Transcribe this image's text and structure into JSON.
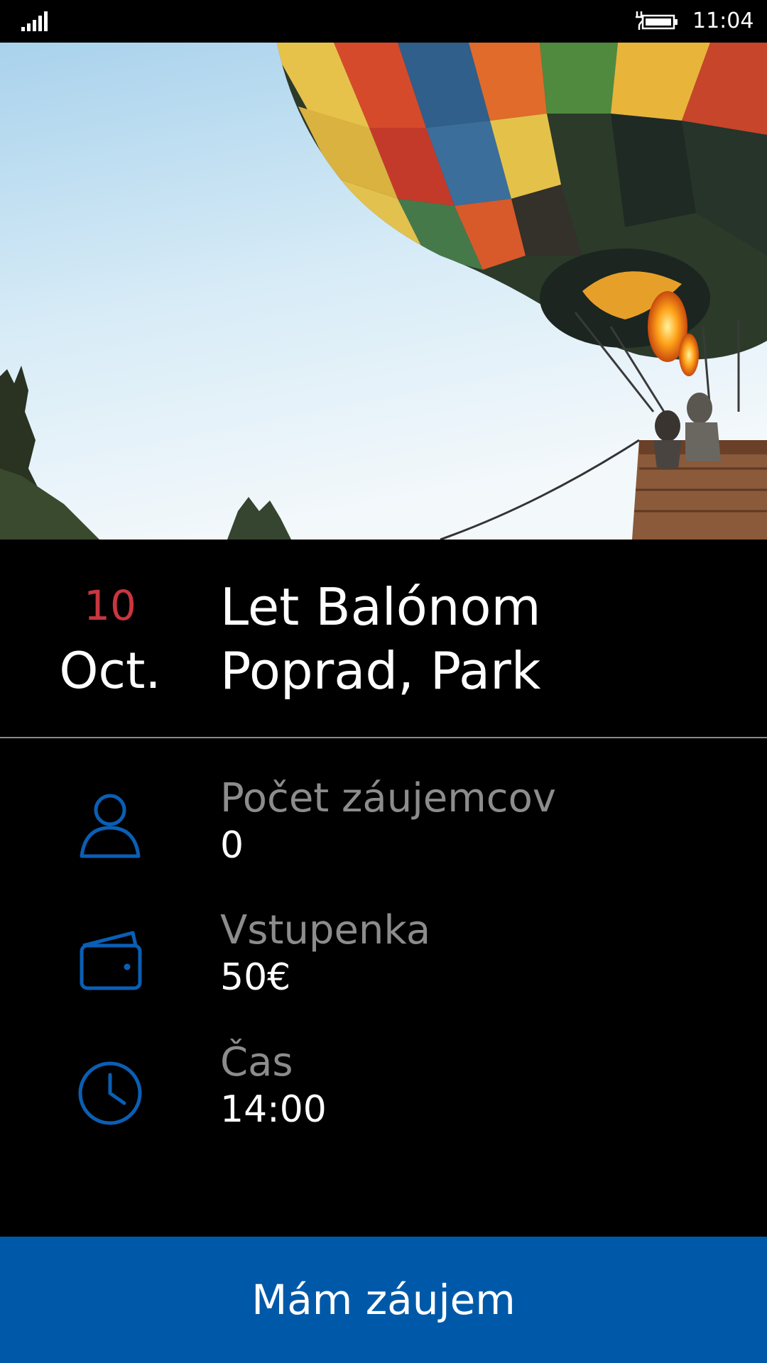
{
  "status_bar": {
    "time": "11:04",
    "signal_icon": "signal-strength-icon",
    "battery_icon": "battery-charging-icon"
  },
  "hero": {
    "image_icon": "hot-air-balloon-photo"
  },
  "event": {
    "day": "10",
    "month": "Oct.",
    "title": "Let Balónom",
    "place": "Poprad, Park"
  },
  "details": [
    {
      "icon": "person-icon",
      "label": "Počet záujemcov",
      "value": "0"
    },
    {
      "icon": "wallet-icon",
      "label": "Vstupenka",
      "value": "50€"
    },
    {
      "icon": "clock-icon",
      "label": "Čas",
      "value": "14:00"
    }
  ],
  "action": {
    "label": "Mám záujem"
  },
  "colors": {
    "accent_blue": "#0059a8",
    "icon_blue": "#0a5fb4",
    "date_red": "#c9363f",
    "label_gray": "#8c8c8c",
    "background": "#000000"
  }
}
